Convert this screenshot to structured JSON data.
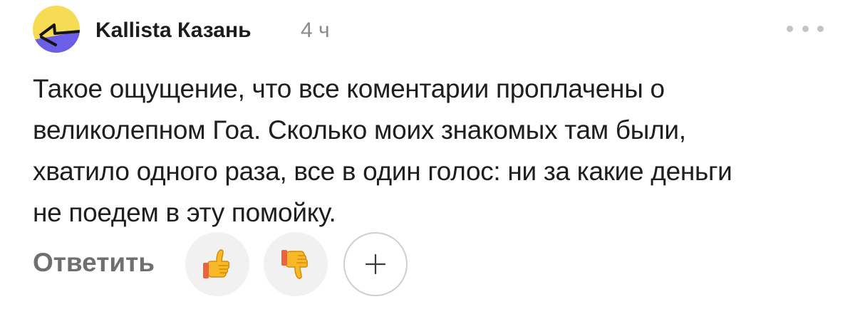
{
  "comment": {
    "author": "Kallista Казань",
    "time": "4 ч",
    "text_lines": [
      "Такое ощущение, что все коментарии проплачены о",
      "великолепном Гоа. Сколько моих знакомых там были,",
      "хватило одного раза, все в один голос: ни за какие деньги",
      "не поедем в эту помойку."
    ]
  },
  "actions": {
    "reply_label": "Ответить",
    "reactions": [
      {
        "icon": "thumbs-up-emoji"
      },
      {
        "icon": "thumbs-down-emoji"
      }
    ],
    "add_reaction_icon": "plus-icon",
    "more_icon": "more-dots-icon"
  },
  "colors": {
    "avatar_yellow": "#F6DB54",
    "avatar_purple": "#6A5FE6",
    "reaction_bg": "#F1F1F1",
    "muted_text": "#8A8A8A",
    "reply_text": "#6F6F6F"
  }
}
